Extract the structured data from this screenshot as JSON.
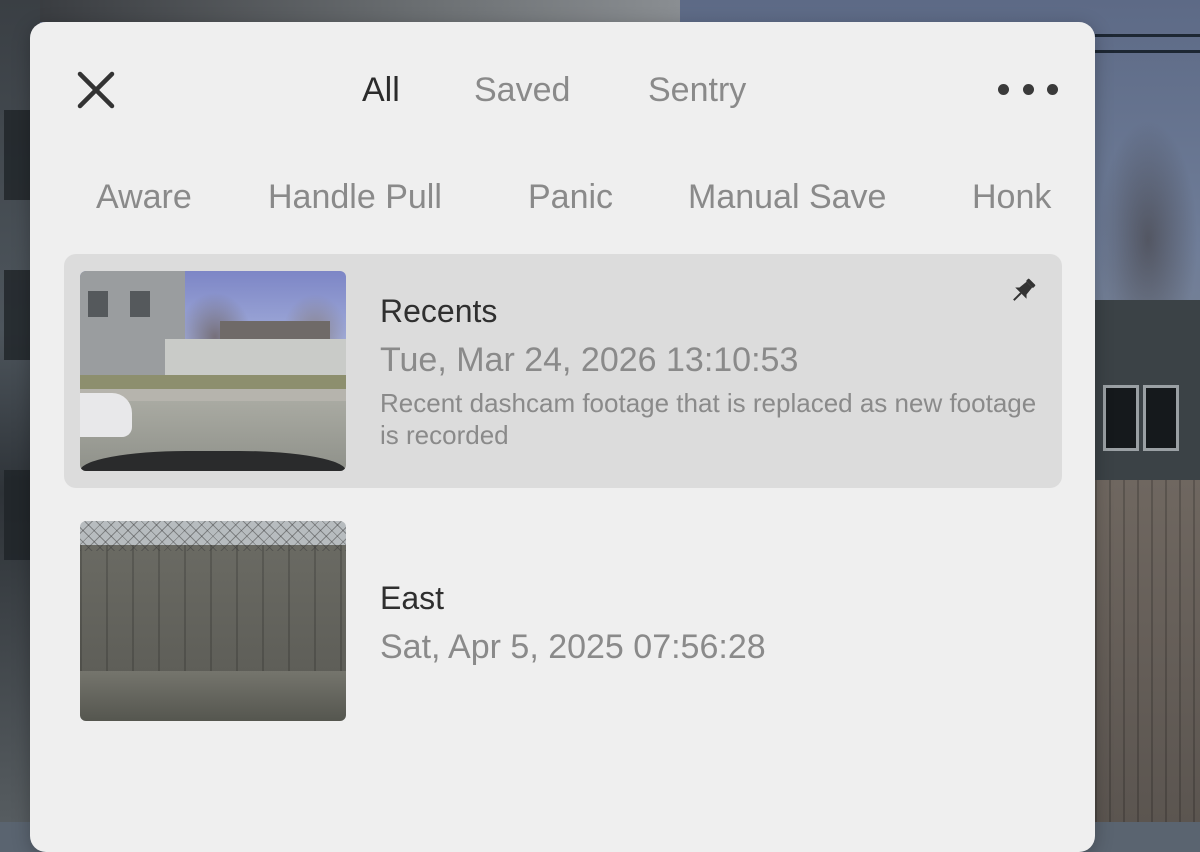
{
  "top_tabs": [
    {
      "label": "All",
      "active": true
    },
    {
      "label": "Saved",
      "active": false
    },
    {
      "label": "Sentry",
      "active": false
    }
  ],
  "filter_tabs": [
    "Aware",
    "Handle Pull",
    "Panic",
    "Manual Save",
    "Honk"
  ],
  "clips": [
    {
      "title": "Recents",
      "date": "Tue, Mar 24, 2026 13:10:53",
      "description": "Recent dashcam footage that is replaced as new footage is recorded",
      "pinned": true,
      "selected": true,
      "icon": "pin-icon"
    },
    {
      "title": "East",
      "date": "Sat, Apr 5, 2025 07:56:28",
      "description": "",
      "pinned": false,
      "selected": false
    }
  ],
  "icons": {
    "close": "close-icon",
    "more": "more-horizontal-icon"
  },
  "colors": {
    "panel_bg": "#efefef",
    "active_text": "#2b2b2b",
    "inactive_text": "#8a8a8a",
    "selected_row": "#dcdcdc"
  }
}
